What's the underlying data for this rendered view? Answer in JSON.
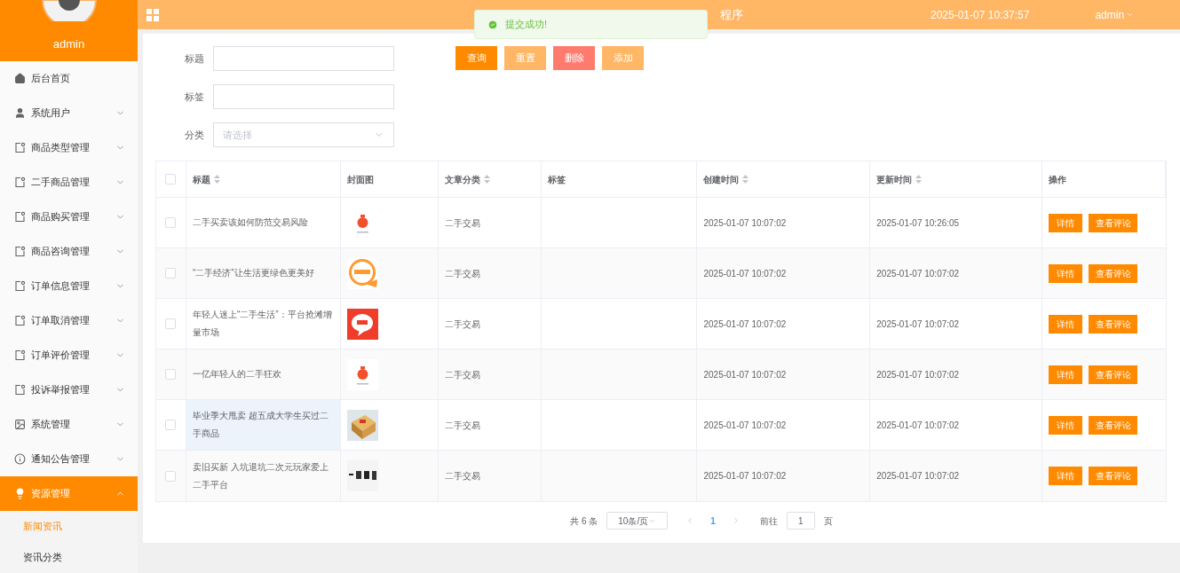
{
  "sidebar": {
    "user": "admin",
    "menu": [
      {
        "label": "后台首页",
        "kind": "link",
        "selected": false
      },
      {
        "label": "系统用户",
        "kind": "submenu",
        "selected": false,
        "expanded": false
      },
      {
        "label": "商品类型管理",
        "kind": "submenu",
        "selected": false,
        "expanded": false
      },
      {
        "label": "二手商品管理",
        "kind": "submenu",
        "selected": false,
        "expanded": false
      },
      {
        "label": "商品购买管理",
        "kind": "submenu",
        "selected": false,
        "expanded": false
      },
      {
        "label": "商品咨询管理",
        "kind": "submenu",
        "selected": false,
        "expanded": false
      },
      {
        "label": "订单信息管理",
        "kind": "submenu",
        "selected": false,
        "expanded": false
      },
      {
        "label": "订单取消管理",
        "kind": "submenu",
        "selected": false,
        "expanded": false
      },
      {
        "label": "订单评价管理",
        "kind": "submenu",
        "selected": false,
        "expanded": false
      },
      {
        "label": "投诉举报管理",
        "kind": "submenu",
        "selected": false,
        "expanded": false
      },
      {
        "label": "系统管理",
        "kind": "submenu",
        "selected": false,
        "expanded": false
      },
      {
        "label": "通知公告管理",
        "kind": "submenu",
        "selected": false,
        "expanded": false
      },
      {
        "label": "资源管理",
        "kind": "submenu",
        "selected": true,
        "expanded": true,
        "children": [
          {
            "label": "新闻资讯",
            "selected": true
          },
          {
            "label": "资讯分类",
            "selected": false
          }
        ]
      }
    ]
  },
  "header": {
    "title_visible": "程序",
    "datetime": "2025-01-07 10:37:57",
    "user": "admin"
  },
  "toast": {
    "message": "提交成功!"
  },
  "filters": [
    {
      "label": "标题",
      "kind": "text"
    },
    {
      "label": "标签",
      "kind": "text"
    },
    {
      "label": "分类",
      "kind": "select",
      "placeholder": "请选择"
    }
  ],
  "buttons": [
    {
      "label": "查询",
      "kind": "primary"
    },
    {
      "label": "重置",
      "kind": "light"
    },
    {
      "label": "删除",
      "kind": "danger"
    },
    {
      "label": "添加",
      "kind": "light"
    }
  ],
  "table": {
    "select_all_checked": false,
    "columns": [
      {
        "label": "标题",
        "sortable": true
      },
      {
        "label": "封面图",
        "sortable": false
      },
      {
        "label": "文章分类",
        "sortable": true
      },
      {
        "label": "标签",
        "sortable": false
      },
      {
        "label": "创建时间",
        "sortable": true
      },
      {
        "label": "更新时间",
        "sortable": true
      },
      {
        "label": "操作",
        "sortable": false
      }
    ],
    "rows": [
      {
        "checked": false,
        "highlighted": false,
        "title": "二手买卖该如何防范交易风险",
        "cover": {
          "kind": "picture"
        },
        "category": "二手交易",
        "created": "2025-01-07 10:07:02",
        "updated": "2025-01-07 10:26:05",
        "actions": [
          "详情",
          "查看评论"
        ]
      },
      {
        "checked": false,
        "highlighted": false,
        "title": "“二手经济”让生活更绿色更美好",
        "cover": {
          "kind": "picture"
        },
        "category": "二手交易",
        "created": "2025-01-07 10:07:02",
        "updated": "2025-01-07 10:07:02",
        "actions": [
          "详情",
          "查看评论"
        ]
      },
      {
        "checked": false,
        "highlighted": false,
        "title": "年轻人迷上“二手生活”：平台抢滩增量市场",
        "cover": {
          "kind": "picture"
        },
        "category": "二手交易",
        "created": "2025-01-07 10:07:02",
        "updated": "2025-01-07 10:07:02",
        "actions": [
          "详情",
          "查看评论"
        ]
      },
      {
        "checked": false,
        "highlighted": false,
        "title": "一亿年轻人的二手狂欢",
        "cover": {
          "kind": "picture"
        },
        "category": "二手交易",
        "created": "2025-01-07 10:07:02",
        "updated": "2025-01-07 10:07:02",
        "actions": [
          "详情",
          "查看评论"
        ]
      },
      {
        "checked": false,
        "highlighted": true,
        "title": "毕业季大甩卖 超五成大学生买过二手商品",
        "cover": {
          "kind": "picture"
        },
        "category": "二手交易",
        "created": "2025-01-07 10:07:02",
        "updated": "2025-01-07 10:07:02",
        "actions": [
          "详情",
          "查看评论"
        ]
      },
      {
        "checked": false,
        "highlighted": false,
        "title": "卖旧买新 入坑退坑二次元玩家爱上二手平台",
        "cover": {
          "kind": "picture"
        },
        "category": "二手交易",
        "created": "2025-01-07 10:07:02",
        "updated": "2025-01-07 10:07:02",
        "actions": [
          "详情",
          "查看评论"
        ]
      }
    ]
  },
  "pagination": {
    "total": "共 6 条",
    "page_size": "10条/页",
    "pages": [
      {
        "label": "1",
        "selected": true
      }
    ],
    "goto_label": "前往",
    "goto_value": "1",
    "page_suffix": "页"
  }
}
